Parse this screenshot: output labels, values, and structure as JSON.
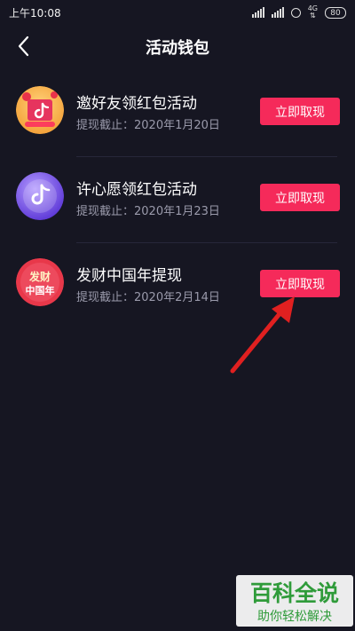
{
  "status_bar": {
    "time": "上午10:08",
    "network": "4G",
    "battery": "80"
  },
  "header": {
    "title": "活动钱包",
    "back_icon": "chevron-left-icon"
  },
  "activities": [
    {
      "title": "邀好友领红包活动",
      "deadline": "提现截止：2020年1月20日",
      "button": "立即取现",
      "icon": "douyin-invite-icon"
    },
    {
      "title": "许心愿领红包活动",
      "deadline": "提现截止：2020年1月23日",
      "button": "立即取现",
      "icon": "douyin-wish-icon"
    },
    {
      "title": "发财中国年提现",
      "deadline": "提现截止：2020年2月14日",
      "button": "立即取现",
      "icon": "facai-new-year-icon",
      "icon_text": [
        "发财",
        "中国年"
      ]
    }
  ],
  "watermark": {
    "title": "百科全说",
    "subtitle": "助你轻松解决"
  },
  "colors": {
    "background": "#161622",
    "button": "#f52a5a",
    "secondary_text": "#9a9aab",
    "arrow": "#e02020",
    "watermark_green": "#2f9b3a"
  }
}
